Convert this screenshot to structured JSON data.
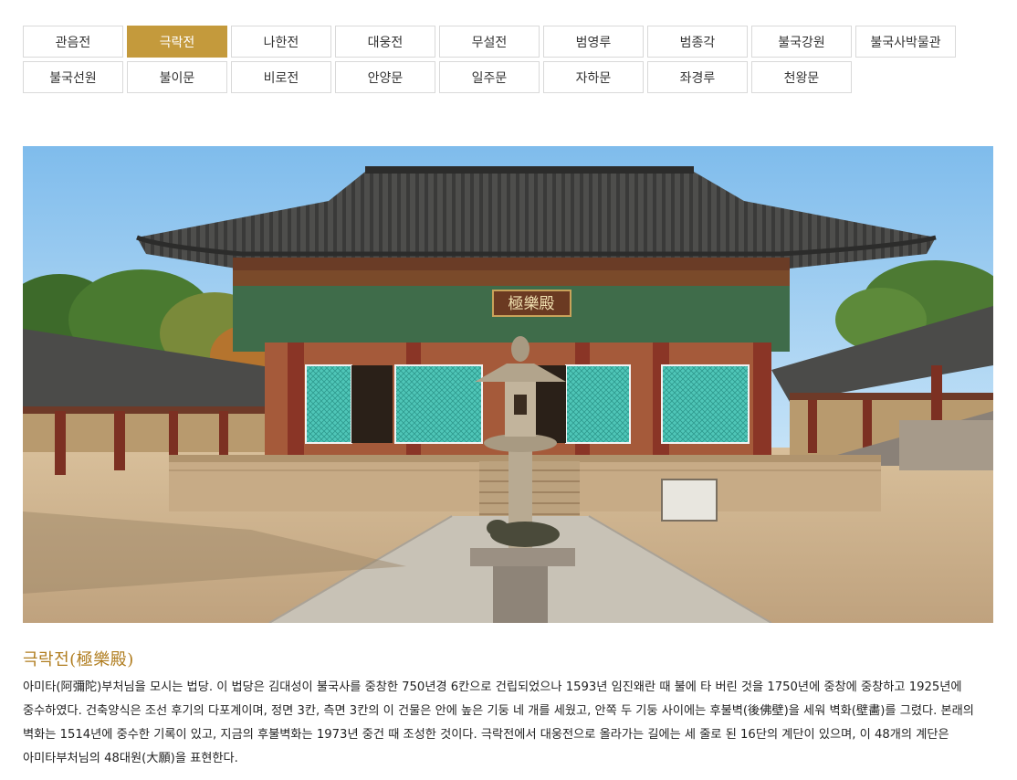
{
  "tabs": {
    "row1": [
      "관음전",
      "극락전",
      "나한전",
      "대웅전",
      "무설전",
      "범영루",
      "범종각",
      "불국강원",
      "불국사박물관"
    ],
    "row2": [
      "불국선원",
      "불이문",
      "비로전",
      "안양문",
      "일주문",
      "자하문",
      "좌경루",
      "천왕문"
    ],
    "active": "극락전"
  },
  "photo": {
    "signboard_text": "極樂殿",
    "colors": {
      "sky": "#9fcdf0",
      "roof": "#4a4a48",
      "pillar": "#8a3526",
      "door": "#44c1b2",
      "ground": "#c9ad8a"
    }
  },
  "content": {
    "title": "극락전(極樂殿)",
    "description": "아미타(阿彌陀)부처님을 모시는 법당. 이 법당은 김대성이 불국사를 중창한 750년경 6칸으로 건립되었으나 1593년 임진왜란 때 불에 타 버린 것을 1750년에 중창에 중창하고 1925년에 중수하였다. 건축양식은 조선 후기의 다포계이며, 정면 3칸, 측면 3칸의 이 건물은 안에 높은 기둥 네 개를 세웠고, 안쪽 두 기둥 사이에는 후불벽(後佛壁)을 세워 벽화(壁畵)를 그렸다. 본래의 벽화는 1514년에 중수한 기록이 있고, 지금의 후불벽화는 1973년 중건 때 조성한 것이다. 극락전에서 대웅전으로 올라가는 길에는 세 줄로 된 16단의 계단이 있으며, 이 48개의 계단은 아미타부처님의 48대원(大願)을 표현한다."
  }
}
